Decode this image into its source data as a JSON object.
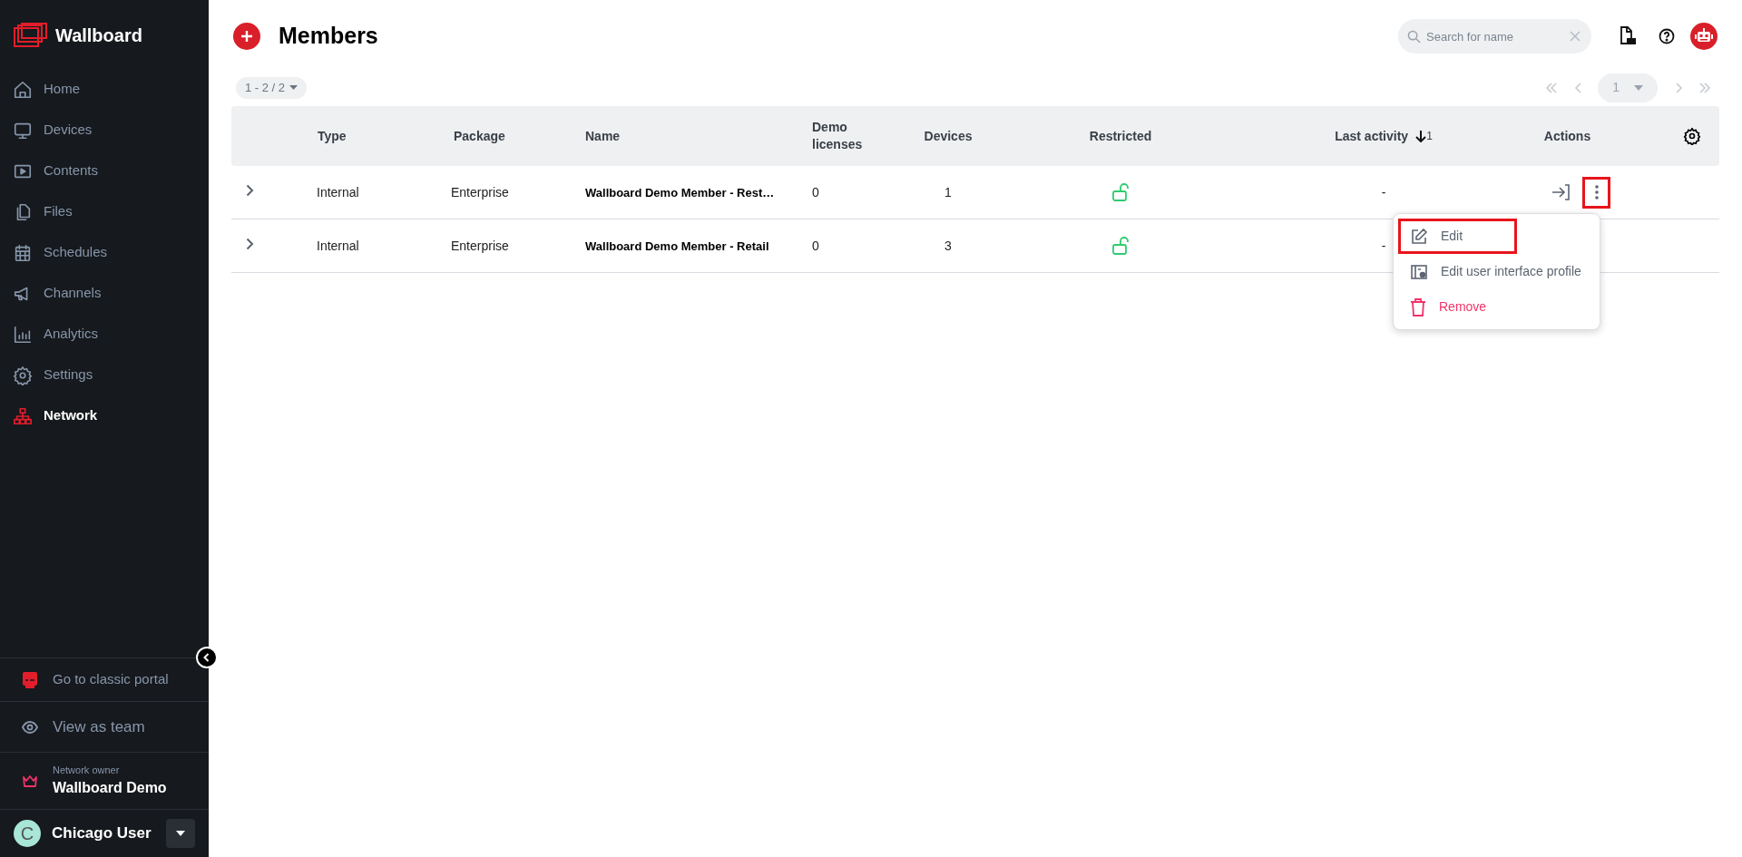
{
  "sidebar": {
    "logo": "Wallboard",
    "items": [
      {
        "label": "Home",
        "selected": false
      },
      {
        "label": "Devices",
        "selected": false
      },
      {
        "label": "Contents",
        "selected": false
      },
      {
        "label": "Files",
        "selected": false
      },
      {
        "label": "Schedules",
        "selected": false
      },
      {
        "label": "Channels",
        "selected": false
      },
      {
        "label": "Analytics",
        "selected": false
      },
      {
        "label": "Settings",
        "selected": false
      },
      {
        "label": "Network",
        "selected": true
      }
    ],
    "classic_portal": "Go to classic portal",
    "view_as_team": "View as team",
    "network_owner": {
      "label": "Network owner",
      "name": "Wallboard Demo"
    },
    "user": {
      "initial": "C",
      "name": "Chicago User"
    }
  },
  "header": {
    "title": "Members",
    "search": {
      "placeholder": "Search for name"
    }
  },
  "range": "1 - 2 / 2",
  "pager": {
    "page": "1"
  },
  "table": {
    "columns": [
      {
        "label": "Type"
      },
      {
        "label": "Package"
      },
      {
        "label": "Name"
      },
      {
        "label": "Demo licenses"
      },
      {
        "label": "Devices"
      },
      {
        "label": "Restricted"
      },
      {
        "label": "Last activity",
        "sort_descending": true,
        "sort_order": "1"
      },
      {
        "label": "Actions"
      }
    ],
    "rows": [
      {
        "type": "Internal",
        "package": "Enterprise",
        "name": "Wallboard Demo Member - Rest…",
        "demo_licenses": "0",
        "devices": "1",
        "restricted": false,
        "last_activity": "-",
        "menu_open": true
      },
      {
        "type": "Internal",
        "package": "Enterprise",
        "name": "Wallboard Demo Member - Retail",
        "demo_licenses": "0",
        "devices": "3",
        "restricted": false,
        "last_activity": "-",
        "menu_open": false
      }
    ]
  },
  "menu": {
    "items": [
      {
        "label": "Edit",
        "kind": "normal",
        "highlighted": true
      },
      {
        "label": "Edit user interface profile",
        "kind": "normal",
        "highlighted": false
      },
      {
        "label": "Remove",
        "kind": "danger",
        "highlighted": false
      }
    ]
  }
}
